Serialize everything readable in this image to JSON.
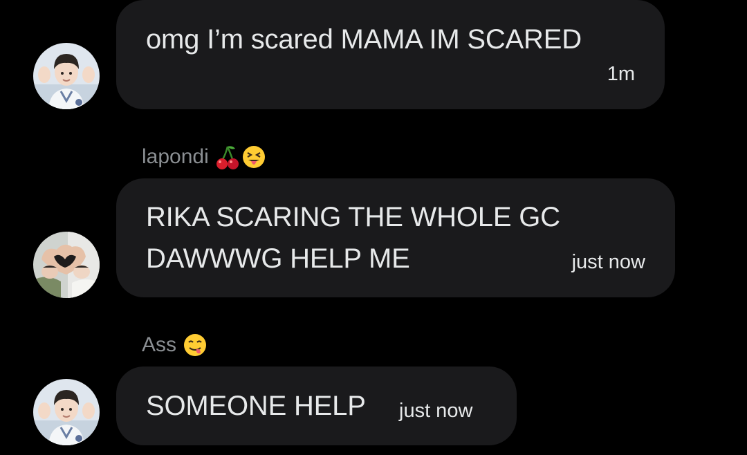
{
  "messages": [
    {
      "sender": "",
      "text_lines": [
        "omg I’m scared MAMA IM SCARED"
      ],
      "time": "1m",
      "avatar": "boy-waving-avatar"
    },
    {
      "sender": "lapondi",
      "sender_emojis": [
        "cherries-emoji",
        "squinting-tongue-face-emoji"
      ],
      "text_lines": [
        "RIKA SCARING THE WHOLE GC",
        "DAWWWG HELP ME"
      ],
      "time": "just now",
      "avatar": "heart-hands-avatar"
    },
    {
      "sender": "Ass",
      "sender_emojis": [
        "yummy-face-emoji"
      ],
      "text_lines": [
        "SOMEONE HELP"
      ],
      "time": "just now",
      "avatar": "boy-waving-avatar"
    }
  ],
  "colors": {
    "background": "#000000",
    "bubble": "#1a1a1c",
    "text": "#e7e9ea",
    "sender": "#8b8f93"
  }
}
